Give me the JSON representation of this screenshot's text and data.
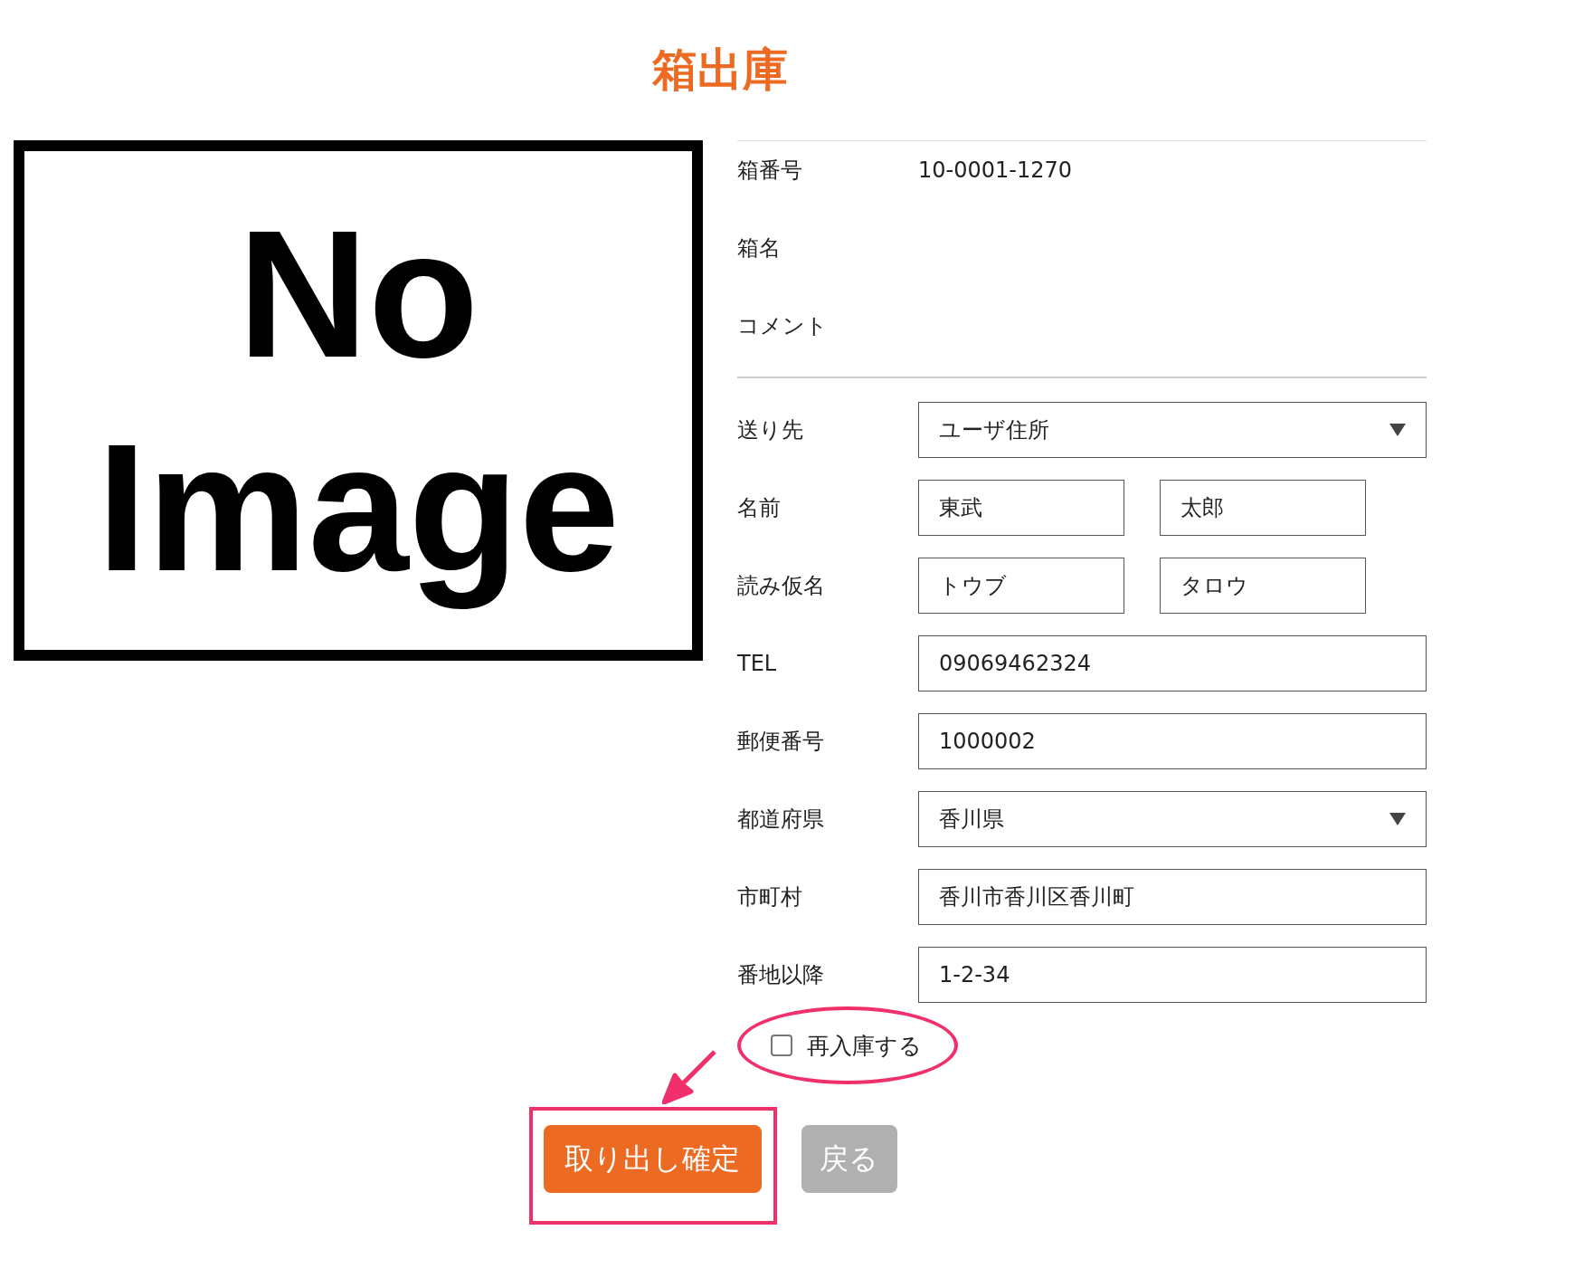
{
  "title": "箱出庫",
  "image_placeholder": {
    "lines": [
      "No",
      "Image"
    ]
  },
  "info": [
    {
      "label": "箱番号",
      "value": "10-0001-1270"
    },
    {
      "label": "箱名"
    },
    {
      "label": "コメント"
    }
  ],
  "fields": [
    {
      "label": "送り先",
      "kind": "select",
      "value": "ユーザ住所"
    },
    {
      "label": "名前",
      "kind": "pair",
      "values": [
        "東武",
        "太郎"
      ]
    },
    {
      "label": "読み仮名",
      "kind": "pair",
      "values": [
        "トウブ",
        "タロウ"
      ]
    },
    {
      "label": "TEL",
      "kind": "text",
      "value": "09069462324"
    },
    {
      "label": "郵便番号",
      "kind": "text",
      "value": "1000002"
    },
    {
      "label": "都道府県",
      "kind": "select",
      "value": "香川県"
    },
    {
      "label": "市町村",
      "kind": "text",
      "value": "香川市香川区香川町"
    },
    {
      "label": "番地以降",
      "kind": "text",
      "value": "1-2-34"
    }
  ],
  "restock": {
    "label": "再入庫する",
    "checked": false
  },
  "buttons": [
    {
      "label": "取り出し確定",
      "kind": "primary"
    },
    {
      "label": "戻る",
      "kind": "secondary"
    }
  ]
}
